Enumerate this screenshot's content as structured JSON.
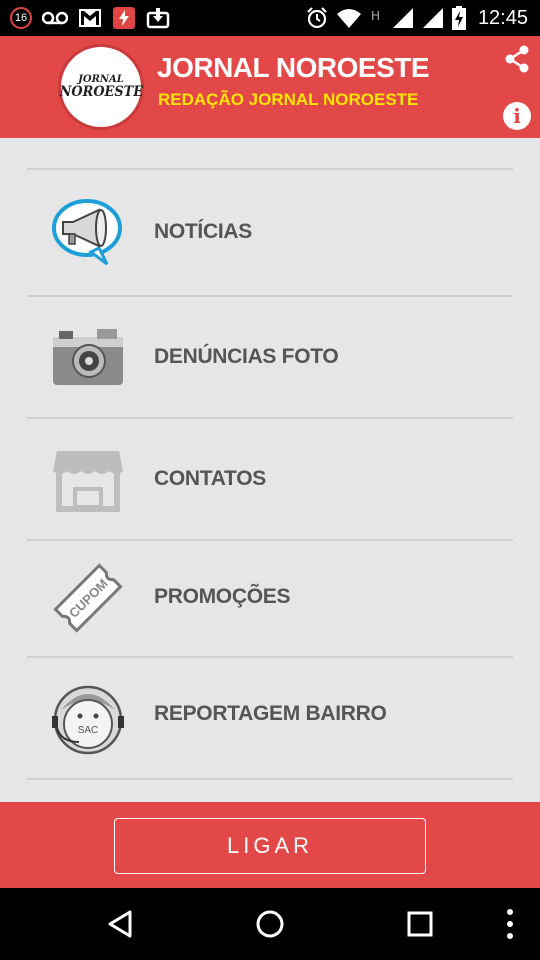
{
  "status_bar": {
    "notification_count": "16",
    "time": "12:45",
    "icons": [
      "voicemail-icon",
      "gmail-icon",
      "app-notification-icon",
      "download-icon",
      "alarm-icon",
      "wifi-icon",
      "h-network-icon",
      "signal-icon",
      "signal-icon",
      "battery-charging-icon"
    ]
  },
  "header": {
    "logo_line1": "JORNAL",
    "logo_line2": "NOROESTE",
    "title": "JORNAL NOROESTE",
    "subtitle": "REDAÇÃO JORNAL NOROESTE",
    "share_icon": "share-icon",
    "info_icon": "info-icon",
    "info_glyph": "i"
  },
  "menu": {
    "items": [
      {
        "label": "NOTÍCIAS",
        "icon": "megaphone-icon"
      },
      {
        "label": "DENÚNCIAS FOTO",
        "icon": "camera-icon"
      },
      {
        "label": "CONTATOS",
        "icon": "storefront-icon"
      },
      {
        "label": "PROMOÇÕES",
        "icon": "coupon-icon"
      },
      {
        "label": "REPORTAGEM BAIRRO",
        "icon": "sac-headset-icon"
      }
    ],
    "coupon_text": "CUPOM",
    "sac_text": "SAC"
  },
  "bottom": {
    "call_label": "LIGAR"
  },
  "nav": {
    "icons": [
      "back-icon",
      "home-icon",
      "recents-icon",
      "overflow-menu-icon"
    ]
  },
  "colors": {
    "brand_red": "#e24848",
    "subtitle_yellow": "#ffe600",
    "menu_text": "#555555",
    "background": "#e6e6e6"
  }
}
